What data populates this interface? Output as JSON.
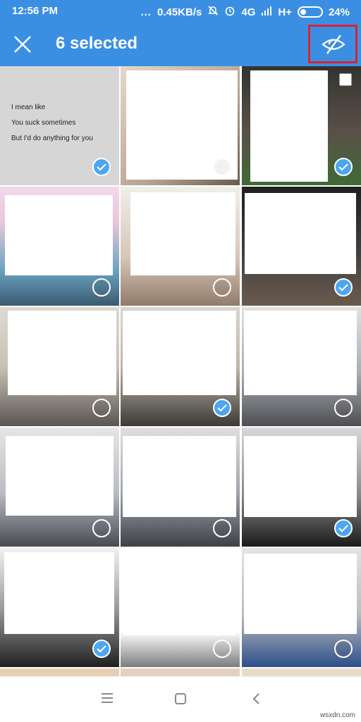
{
  "status_bar": {
    "time": "12:56 PM",
    "dots": "...",
    "speed": "0.45KB/s",
    "network": "4G",
    "network2": "H+",
    "battery": "24%"
  },
  "app_bar": {
    "title": "6 selected",
    "close_icon": "close-icon",
    "hide_icon": "eye-off-icon",
    "highlight_color": "#d9232e"
  },
  "quote_tile": {
    "lines": [
      "I mean like",
      "You suck sometimes",
      "But I'd do anything for you"
    ]
  },
  "tiles": [
    {
      "checked": true
    },
    {
      "checked": false
    },
    {
      "checked": true
    },
    {
      "checked": false
    },
    {
      "checked": false
    },
    {
      "checked": true
    },
    {
      "checked": false
    },
    {
      "checked": true
    },
    {
      "checked": false
    },
    {
      "checked": false
    },
    {
      "checked": false
    },
    {
      "checked": true
    },
    {
      "checked": true
    },
    {
      "checked": false
    },
    {
      "checked": false
    }
  ],
  "nav_bar": {
    "menu_icon": "menu-icon",
    "home_icon": "home-square-icon",
    "back_icon": "back-chevron-icon"
  },
  "watermark": "wsxdn.com",
  "colors": {
    "primary": "#3b8fe3",
    "check": "#4da6f2"
  }
}
